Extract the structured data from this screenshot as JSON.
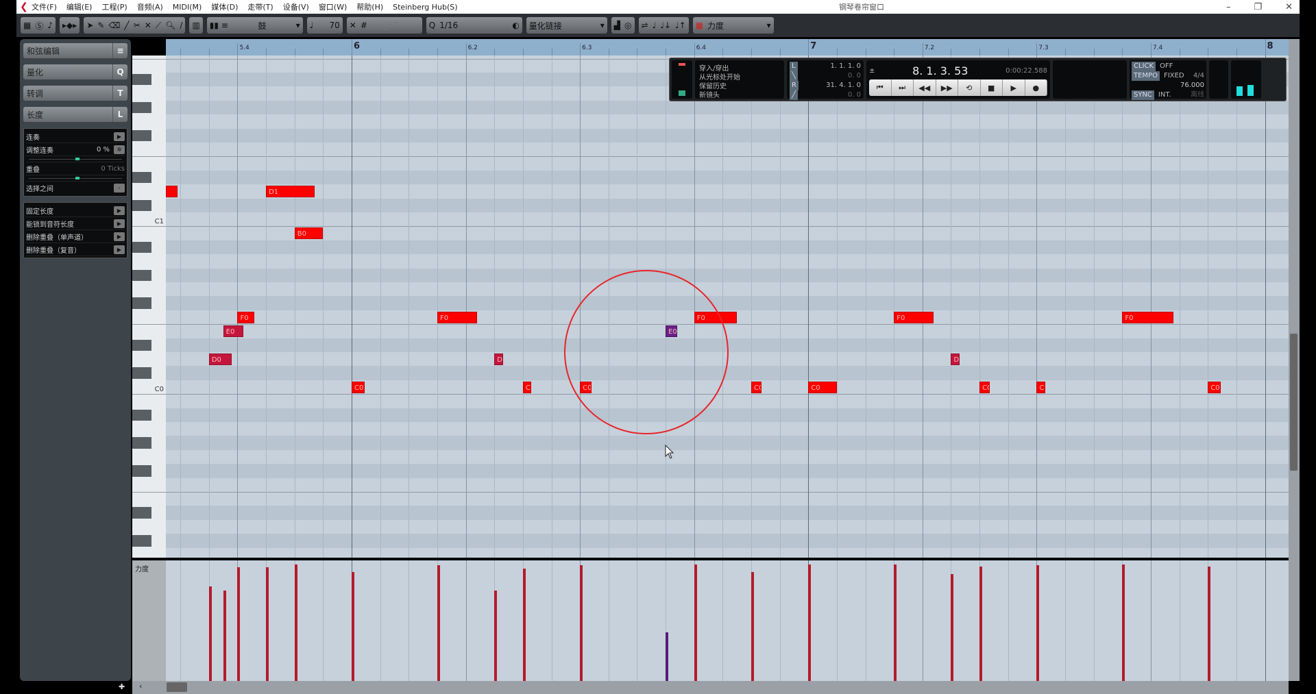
{
  "window": {
    "title": "钢琴卷帘窗口",
    "menu": [
      "文件(F)",
      "编辑(E)",
      "工程(P)",
      "音频(A)",
      "MIDI(M)",
      "媒体(D)",
      "走带(T)",
      "设备(V)",
      "窗口(W)",
      "帮助(H)",
      "Steinberg Hub(S)"
    ],
    "controls": [
      "–",
      "❐",
      "✕"
    ]
  },
  "toolbar": {
    "tools": [
      "pointer-icon",
      "pencil-icon",
      "eraser-icon",
      "brush-icon",
      "split-icon",
      "mute-icon",
      "glue-icon",
      "zoom-icon",
      "line-icon"
    ],
    "drum_map": "鼓",
    "insert_velocity": "70",
    "quantize": "1/16",
    "quantize_link": "量化链接",
    "lane_select": "力度"
  },
  "left_panel": {
    "sections": [
      {
        "label": "和弦编辑",
        "key": "≡"
      },
      {
        "label": "量化",
        "key": "Q"
      },
      {
        "label": "转调",
        "key": "T"
      },
      {
        "label": "长度",
        "key": "L"
      }
    ],
    "legato": {
      "label": "连奏",
      "adjust_label": "调整连奏",
      "adjust_value": "0 %",
      "overlap_label": "重叠",
      "overlap_value": "0 Ticks",
      "between_label": "选择之间"
    },
    "length_actions": [
      "固定长度",
      "能锁到音符长度",
      "删除重叠（单声道）",
      "删除重叠（复音）"
    ]
  },
  "keyboard": {
    "labels": [
      {
        "text": "C1",
        "pitch": 12
      },
      {
        "text": "C0",
        "pitch": 0
      }
    ]
  },
  "ruler": [
    "5.4",
    "6",
    "6.2",
    "6.3",
    "6.4",
    "7",
    "7.2",
    "7.3",
    "7.4",
    "8"
  ],
  "velocity_lane": {
    "label": "力度"
  },
  "colors": {
    "note_high": "#ff0000",
    "note_mid": "#c4163c",
    "note_low": "#6a1f86",
    "vel_line": "#b31b2b",
    "vel_low": "#5a1a7a",
    "annotation_circle": "#e8242a"
  },
  "notes": [
    {
      "label": "",
      "pitch": 14,
      "start16": 9.5,
      "len16": 0.4,
      "velocity": null
    },
    {
      "label": "D0",
      "pitch": 2,
      "start16": 11,
      "len16": 0.8,
      "velocity": 101
    },
    {
      "label": "E0",
      "pitch": 4,
      "start16": 11.5,
      "len16": 0.7,
      "velocity": 96
    },
    {
      "label": "F0",
      "pitch": 5,
      "start16": 12,
      "len16": 0.6,
      "velocity": 121
    },
    {
      "label": "D1",
      "pitch": 14,
      "start16": 13,
      "len16": 1.7,
      "velocity": 121
    },
    {
      "label": "B0",
      "pitch": 11,
      "start16": 14,
      "len16": 1.0,
      "velocity": 124
    },
    {
      "label": "C0",
      "pitch": 0,
      "start16": 16,
      "len16": 0.45,
      "velocity": 116
    },
    {
      "label": "F0",
      "pitch": 5,
      "start16": 19,
      "len16": 1.4,
      "velocity": 123
    },
    {
      "label": "D",
      "pitch": 2,
      "start16": 21,
      "len16": 0.3,
      "velocity": 96
    },
    {
      "label": "C",
      "pitch": 0,
      "start16": 22,
      "len16": 0.3,
      "velocity": 120
    },
    {
      "label": "C0",
      "pitch": 0,
      "start16": 24,
      "len16": 0.4,
      "velocity": 123
    },
    {
      "label": "E0",
      "pitch": 4,
      "start16": 27,
      "len16": 0.4,
      "velocity": 52
    },
    {
      "label": "F0",
      "pitch": 5,
      "start16": 28,
      "len16": 1.5,
      "velocity": 124
    },
    {
      "label": "C0",
      "pitch": 0,
      "start16": 30,
      "len16": 0.35,
      "velocity": 116
    },
    {
      "label": "C0",
      "pitch": 0,
      "start16": 32,
      "len16": 1.0,
      "velocity": 124
    },
    {
      "label": "F0",
      "pitch": 5,
      "start16": 35,
      "len16": 1.4,
      "velocity": 124
    },
    {
      "label": "D",
      "pitch": 2,
      "start16": 37,
      "len16": 0.3,
      "velocity": 114
    },
    {
      "label": "C0",
      "pitch": 0,
      "start16": 38,
      "len16": 0.35,
      "velocity": 122
    },
    {
      "label": "C0",
      "pitch": 0,
      "start16": 40,
      "len16": 0.3,
      "velocity": 123
    },
    {
      "label": "F0",
      "pitch": 5,
      "start16": 43,
      "len16": 1.8,
      "velocity": 124
    },
    {
      "label": "C0",
      "pitch": 0,
      "start16": 46,
      "len16": 0.45,
      "velocity": 122
    }
  ],
  "transport": {
    "record_modes": [
      "穿入/穿出",
      "从光标处开始",
      "保留历史",
      "新镜头"
    ],
    "left_locator": "1. 1. 1.  0",
    "left_offset": "0.  0",
    "right_locator": "31. 4. 1.  0",
    "right_offset": "0.  0",
    "position": "8. 1. 3. 53",
    "time": "0:00:22.588",
    "buttons": [
      "⏮",
      "⏭",
      "◀◀",
      "▶▶",
      "⟲",
      "■",
      "▶",
      "●"
    ],
    "click_label": "CLICK",
    "click_value": "OFF",
    "tempo_label": "TEMPO",
    "tempo_mode": "FIXED",
    "signature": "4/4",
    "tempo": "76.000",
    "sync_label": "SYNC",
    "sync_value": "INT.",
    "sync_status": "离线"
  }
}
